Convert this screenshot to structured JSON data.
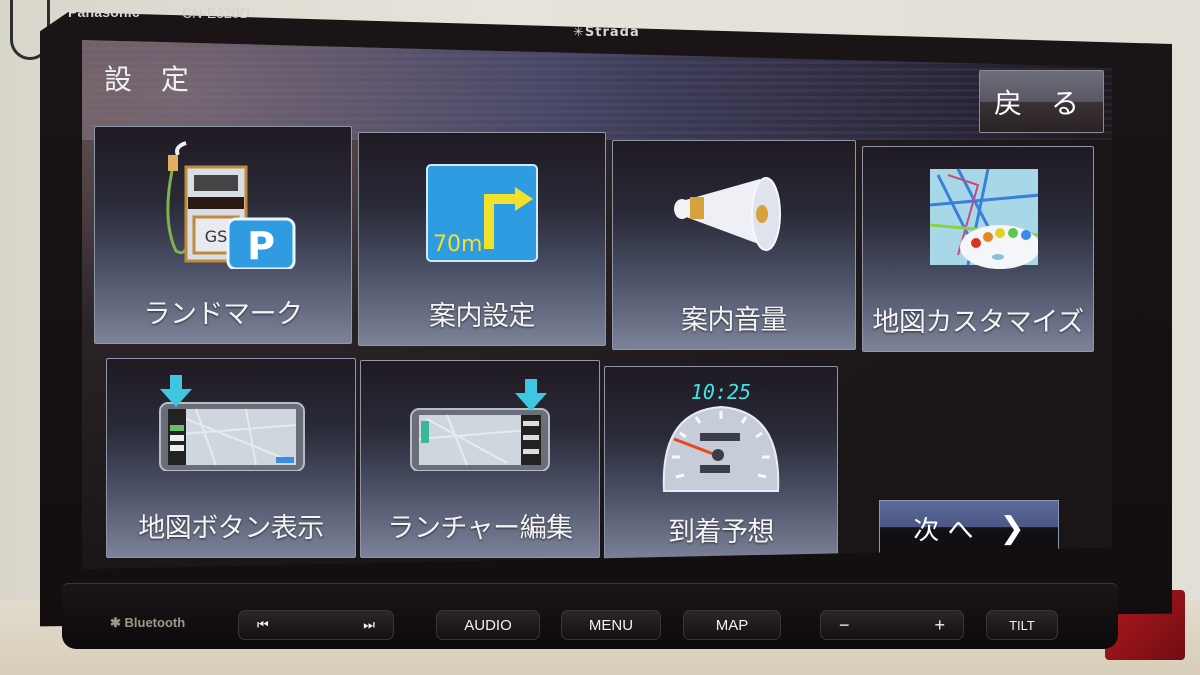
{
  "device": {
    "brand": "Panasonic",
    "model": "CN-E320D",
    "series": "✳Strada"
  },
  "header": {
    "title": "設 定",
    "back_label": "戻 る"
  },
  "menu": {
    "items": [
      {
        "label": "ランドマーク",
        "icon": "gas-station-parking-icon"
      },
      {
        "label": "案内設定",
        "icon": "turn-sign-icon",
        "sign_text": "70m"
      },
      {
        "label": "案内音量",
        "icon": "megaphone-icon"
      },
      {
        "label": "地図カスタマイズ",
        "icon": "map-palette-icon"
      },
      {
        "label": "地図ボタン表示",
        "icon": "map-buttons-icon"
      },
      {
        "label": "ランチャー編集",
        "icon": "launcher-edit-icon"
      },
      {
        "label": "到着予想",
        "icon": "speedometer-icon",
        "clock_text": "10:25"
      }
    ],
    "gs_text": "GS",
    "parking_text": "P"
  },
  "pagination": {
    "next_label": "次 へ",
    "next_chevron": "❯"
  },
  "hardware": {
    "bluetooth_label": "Bluetooth",
    "prev_track": "⏮",
    "next_track": "⏭",
    "audio": "AUDIO",
    "menu": "MENU",
    "map": "MAP",
    "vol_down": "−",
    "vol_up": "+",
    "tilt": "TILT"
  },
  "colors": {
    "sign_blue": "#2f9be0",
    "sign_yellow": "#f2e12a",
    "clock_cyan": "#3fe3e8",
    "arrow_cyan": "#3ec7e0"
  }
}
